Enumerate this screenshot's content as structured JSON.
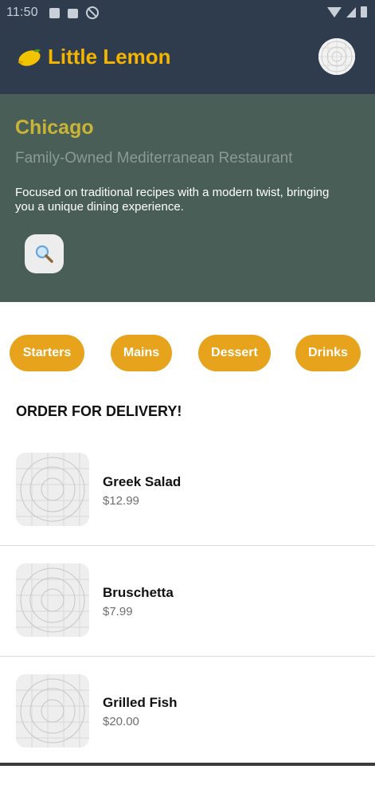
{
  "status_bar": {
    "time": "11:50"
  },
  "header": {
    "title": "Little Lemon"
  },
  "hero": {
    "city": "Chicago",
    "subtitle": "Family-Owned Mediterranean Restaurant",
    "description": "Focused on traditional recipes with a modern twist, bringing you a unique dining experience."
  },
  "categories": [
    "Starters",
    "Mains",
    "Dessert",
    "Drinks"
  ],
  "section_title": "ORDER FOR DELIVERY!",
  "menu": [
    {
      "name": "Greek Salad",
      "price": "$12.99"
    },
    {
      "name": "Bruschetta",
      "price": "$7.99"
    },
    {
      "name": "Grilled Fish",
      "price": "$20.00"
    }
  ],
  "colors": {
    "header_bg": "#2f3c4d",
    "brand_yellow": "#f4b400",
    "hero_bg": "#495e57",
    "city_color": "#c9b436",
    "pill_bg": "#e7a31c"
  }
}
